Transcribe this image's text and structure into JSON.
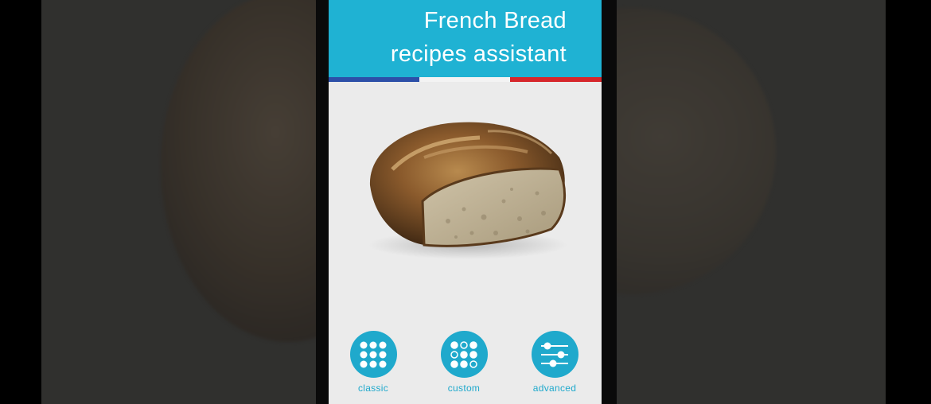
{
  "header": {
    "title_line1": "French Bread",
    "title_line2": "recipes assistant"
  },
  "colors": {
    "accent": "#1fb2d3",
    "flag_blue": "#2c4fa8",
    "flag_white": "#f3f3f3",
    "flag_red": "#d6272b"
  },
  "hero": {
    "icon": "bread-loaf-image"
  },
  "actions": [
    {
      "label": "classic",
      "icon": "grid-dots-icon"
    },
    {
      "label": "custom",
      "icon": "grid-dots-mixed-icon"
    },
    {
      "label": "advanced",
      "icon": "sliders-icon"
    }
  ]
}
